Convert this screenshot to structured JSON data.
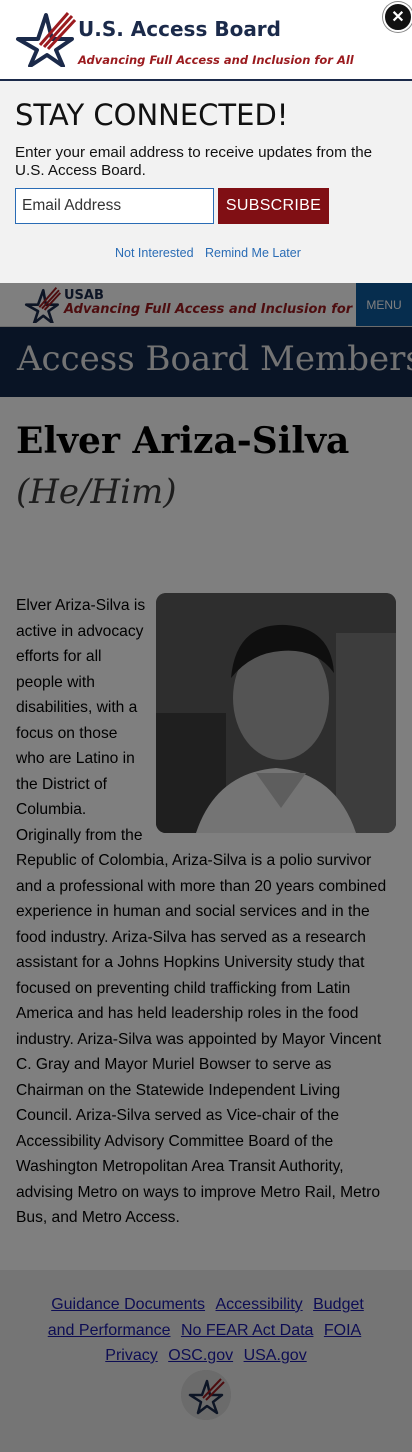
{
  "colors": {
    "navy": "#1b2a4a",
    "brand_red": "#9b1b1f",
    "subscribe_red": "#800f14",
    "link_blue": "#2a6cb5",
    "banner_navy": "#13294b",
    "menu_blue": "#0d5a9c"
  },
  "modal": {
    "brand": "U.S. Access Board",
    "tagline": "Advancing Full Access and Inclusion for All",
    "close_icon": "close-x-icon",
    "heading": "STAY CONNECTED!",
    "description": "Enter your email address to receive updates from the U.S. Access Board.",
    "email_placeholder": "Email Address",
    "subscribe_label": "SUBSCRIBE",
    "not_interested": "Not Interested",
    "remind_later": "Remind Me Later"
  },
  "header": {
    "short_name": "USAB",
    "tagline": "Advancing Full Access and Inclusion for All",
    "menu_label": "MENU"
  },
  "banner": {
    "title": "Access Board Members"
  },
  "member": {
    "name": "Elver Ariza-Silva",
    "pronouns": "(He/Him)",
    "photo_icon": "portrait-photo",
    "bio": "Elver Ariza-Silva is active in advocacy efforts for all people with disabilities, with a focus on those who are Latino in the District of Columbia. Originally from the Republic of Colombia, Ariza-Silva is a polio survivor and a professional with more than 20 years combined experience in human and social services and in the food industry. Ariza-Silva has served as a research assistant for a Johns Hopkins University study that focused on preventing child trafficking from Latin America and has held leadership roles in the food industry. Ariza-Silva was appointed by Mayor Vincent C. Gray and Mayor Muriel Bowser to serve as Chairman on the Statewide Independent Living Council. Ariza-Silva served as Vice-chair of the Accessibility Advisory Committee Board of the Washington Metropolitan Area Transit Authority, advising Metro on ways to improve Metro Rail, Metro Bus, and Metro Access."
  },
  "footer": {
    "links": [
      "Guidance Documents",
      "Accessibility",
      "Budget and Performance",
      "No FEAR Act Data",
      "FOIA",
      "Privacy",
      "OSC.gov",
      "USA.gov"
    ],
    "seal_icon": "star-seal-icon"
  }
}
